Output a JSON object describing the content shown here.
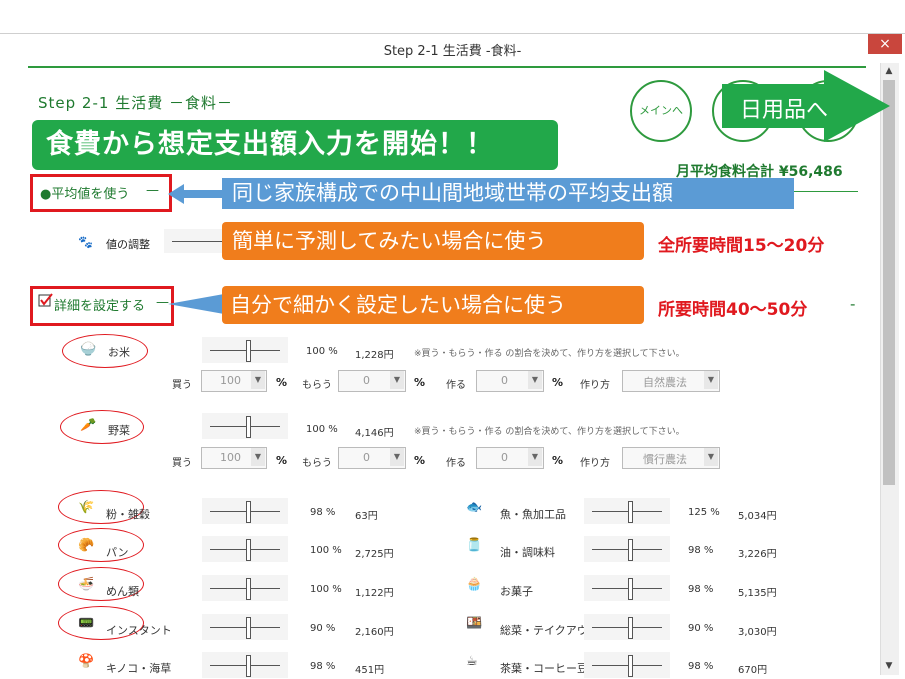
{
  "window": {
    "title": "Step 2-1 生活費 -食料-",
    "close": "×"
  },
  "scroll": {
    "up": "▲",
    "down": "▼"
  },
  "header": {
    "step": "Step 2-1 生活費 －食料－",
    "banner": "食費から想定支出額入力を開始！！",
    "menu_button": "メインへ",
    "next_button": "日用品へ",
    "total": "月平均食料合計 ¥56,486"
  },
  "options": {
    "average": {
      "label": "●平均値を使う",
      "dash": "—"
    },
    "detail": {
      "label": "詳細を設定する",
      "dash": "—"
    },
    "callout_average": "同じ家族構成での中山間地域世帯の平均支出額",
    "callout_simple": "簡単に予測してみたい場合に使う",
    "callout_detail": "自分で細かく設定したい場合に使う",
    "time_simple": "全所要時間15〜20分",
    "time_detail": "所要時間40〜50分",
    "time_detail_dash": "-"
  },
  "adjust": {
    "label": "値の調整"
  },
  "note": "※買う・もらう・作る の割合を決めて、作り方を選択して下さい。",
  "sub_labels": {
    "buy": "買う",
    "receive": "もらう",
    "make": "作る",
    "method": "作り方",
    "pct": "%"
  },
  "rice": {
    "label": "お米",
    "pct": "100 %",
    "yen": "1,228円",
    "buy": "100",
    "receive": "0",
    "make": "0",
    "method": "自然農法"
  },
  "veg": {
    "label": "野菜",
    "pct": "100 %",
    "yen": "4,146円",
    "buy": "100",
    "receive": "0",
    "make": "0",
    "method": "慣行農法"
  },
  "left_items": [
    {
      "label": "粉・雑穀",
      "pct": "98 %",
      "yen": "63円"
    },
    {
      "label": "パン",
      "pct": "100 %",
      "yen": "2,725円"
    },
    {
      "label": "めん類",
      "pct": "100 %",
      "yen": "1,122円"
    },
    {
      "label": "インスタント",
      "pct": "90 %",
      "yen": "2,160円"
    },
    {
      "label": "キノコ・海草",
      "pct": "98 %",
      "yen": "451円"
    }
  ],
  "right_items": [
    {
      "label": "魚・魚加工品",
      "pct": "125 %",
      "yen": "5,034円"
    },
    {
      "label": "油・調味料",
      "pct": "98 %",
      "yen": "3,226円"
    },
    {
      "label": "お菓子",
      "pct": "98 %",
      "yen": "5,135円"
    },
    {
      "label": "総菜・テイクアウト",
      "pct": "90 %",
      "yen": "3,030円"
    },
    {
      "label": "茶葉・コーヒー豆等",
      "pct": "98 %",
      "yen": "670円"
    }
  ],
  "colors": {
    "green": "#22a84a",
    "red": "#e0191f",
    "blue": "#5b9bd5",
    "orange": "#f07d1c"
  }
}
